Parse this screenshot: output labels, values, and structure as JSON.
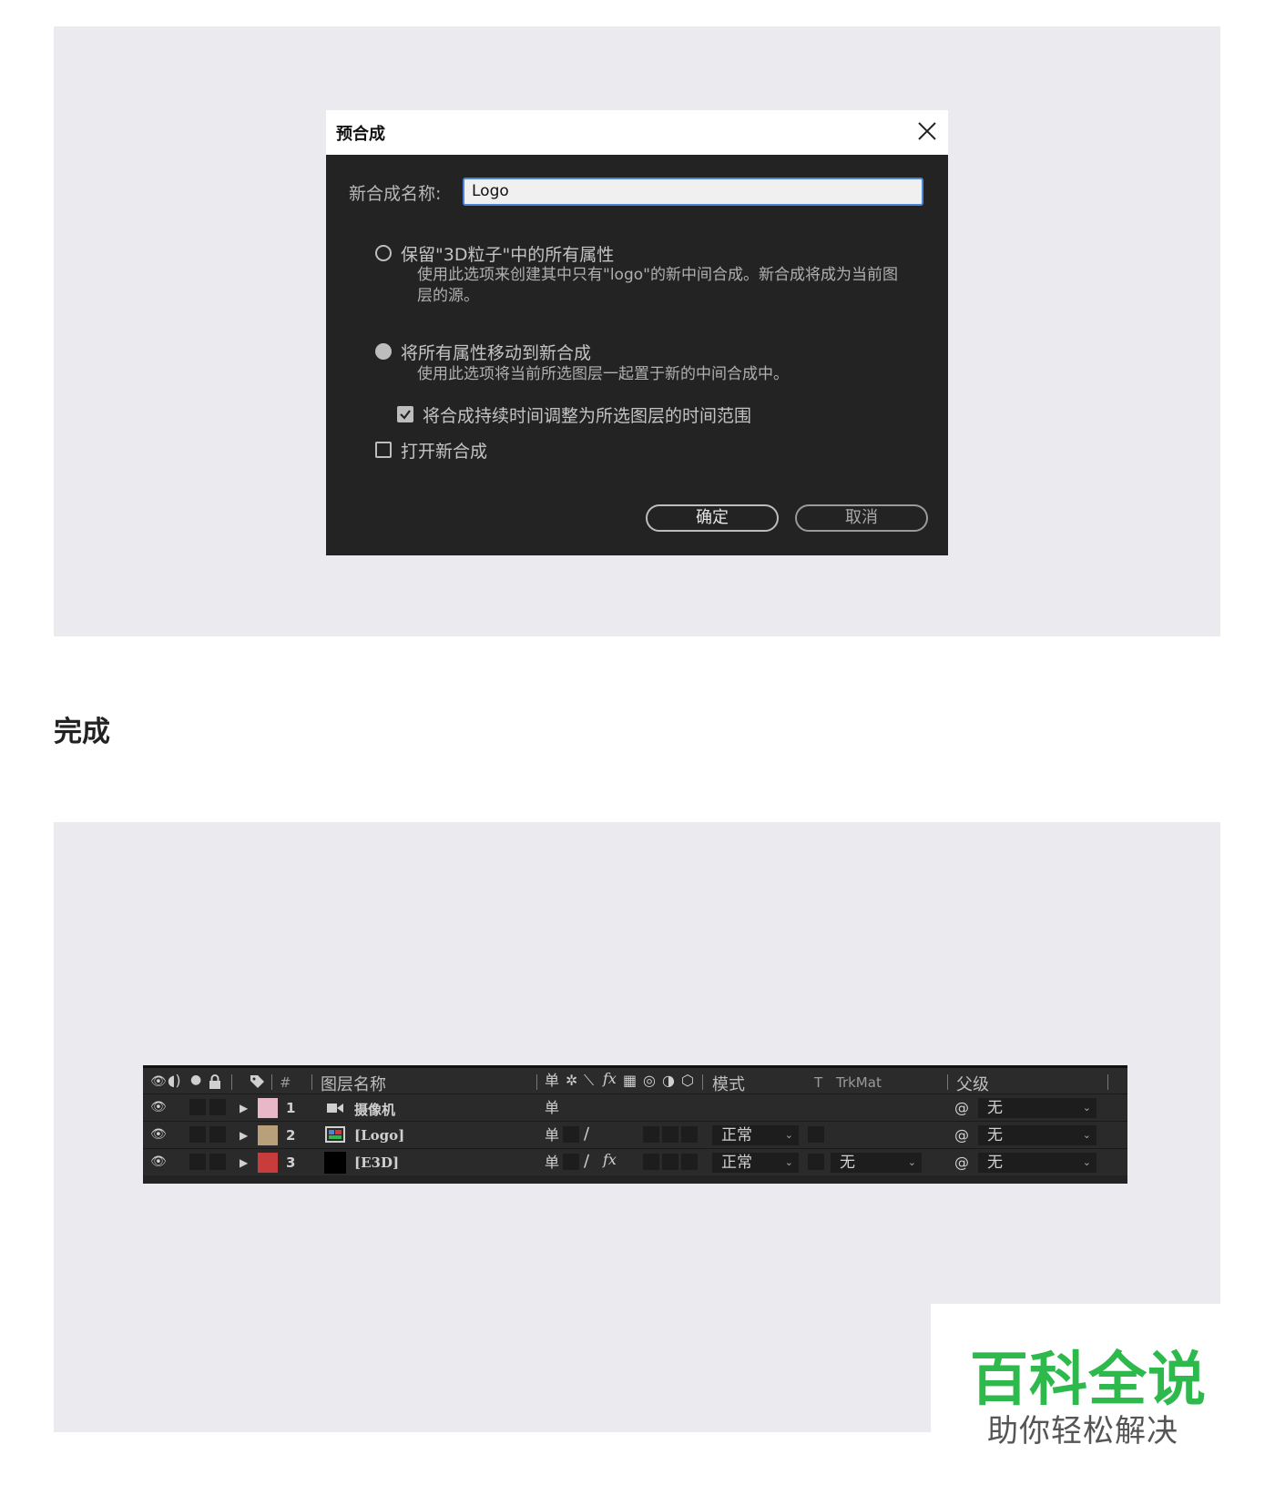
{
  "dialog": {
    "title": "预合成",
    "name_label": "新合成名称:",
    "name_value": "Logo",
    "option1_label": "保留\"3D粒子\"中的所有属性",
    "option1_desc": "使用此选项来创建其中只有\"logo\"的新中间合成。新合成将成为当前图层的源。",
    "option2_label": "将所有属性移动到新合成",
    "option2_desc": "使用此选项将当前所选图层一起置于新的中间合成中。",
    "adjust_label": "将合成持续时间调整为所选图层的时间范围",
    "open_label": "打开新合成",
    "ok_label": "确定",
    "cancel_label": "取消"
  },
  "heading": "完成",
  "timeline": {
    "headers": {
      "index": "#",
      "layer_name": "图层名称",
      "mode": "模式",
      "t": "T",
      "trkmat": "TrkMat",
      "parent": "父级"
    },
    "rows": [
      {
        "index": "1",
        "name": "摄像机",
        "color": "#e8b8c8",
        "mode": "",
        "trkmat": "",
        "parent": "无",
        "fx": ""
      },
      {
        "index": "2",
        "name": "[Logo]",
        "color": "#b8a07a",
        "mode": "正常",
        "trkmat": "",
        "parent": "无",
        "fx": ""
      },
      {
        "index": "3",
        "name": "[E3D]",
        "color": "#c83c3c",
        "mode": "正常",
        "trkmat": "无",
        "parent": "无",
        "fx": "fx"
      }
    ],
    "header_fx": "fx"
  },
  "watermark": {
    "title": "百科全说",
    "subtitle": "助你轻松解决"
  }
}
